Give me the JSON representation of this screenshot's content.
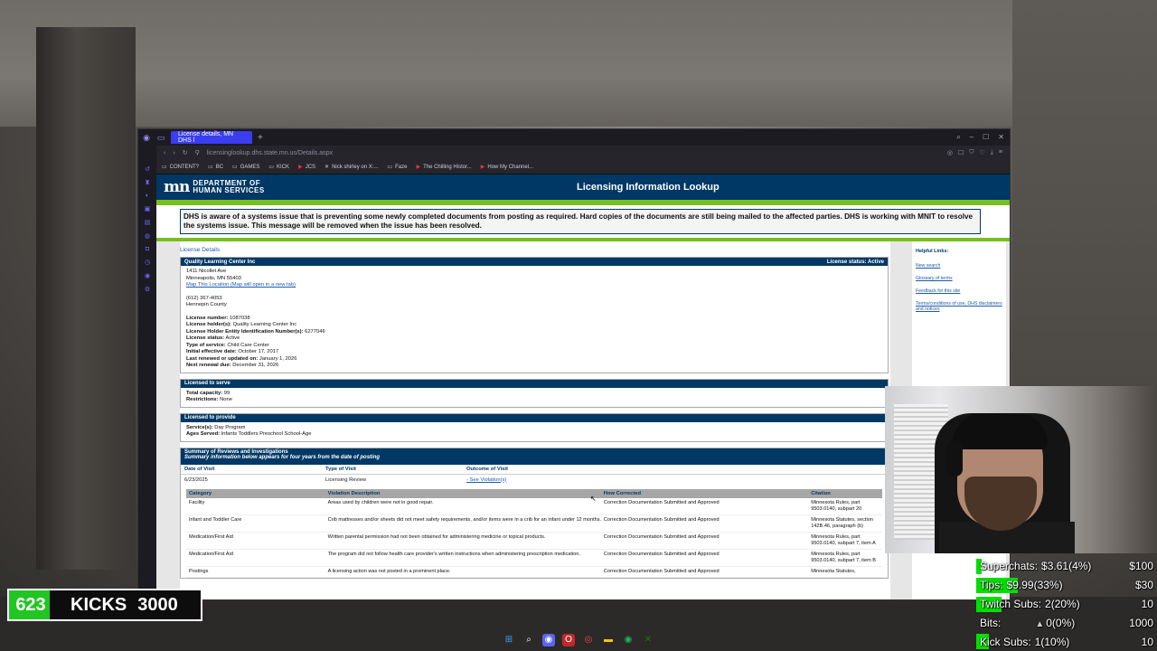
{
  "browser": {
    "tab_title": "License details, MN DHS l",
    "address": "licensinglookup.dhs.state.mn.us/Details.aspx",
    "bookmarks": [
      {
        "label": "CONTENT?",
        "icon": "folder-icon"
      },
      {
        "label": "BC",
        "icon": "folder-icon"
      },
      {
        "label": "GAMES",
        "icon": "folder-icon"
      },
      {
        "label": "KICK",
        "icon": "folder-icon"
      },
      {
        "label": "JCS",
        "icon": "youtube-icon"
      },
      {
        "label": "Nick shirley on X:...",
        "icon": "x-icon"
      },
      {
        "label": "Faze",
        "icon": "folder-icon"
      },
      {
        "label": "The Chilling Histor...",
        "icon": "youtube-icon"
      },
      {
        "label": "How My Channel...",
        "icon": "youtube-icon"
      }
    ]
  },
  "dhs": {
    "logo_line1": "DEPARTMENT OF",
    "logo_line2": "HUMAN SERVICES",
    "page_title": "Licensing Information Lookup",
    "alert": "DHS is aware of a systems issue that is preventing some newly completed documents from posting as required. Hard copies of the documents are still being mailed to the affected parties. DHS is working with MNIT to resolve the systems issue.  This message will be removed when the issue has been resolved.",
    "helpful_links": {
      "title": "Helpful Links:",
      "links": [
        "New search",
        "Glossary of terms",
        "Feedback for this site",
        "Terms/conditions of use, DHS disclaimers and notices"
      ]
    },
    "license_details_title": "License Details",
    "provider": {
      "name": "Quality Learning Center Inc",
      "status_header": "License status: Active",
      "address1": "1411 Nicollet Ave",
      "address2": "Minneapolis, MN 55403",
      "map_link": "Map This Location (Map will open in a new tab)",
      "phone": "(612) 367-4053",
      "county": "Hennepin County",
      "license_number_label": "License number:",
      "license_number": "1087038",
      "holder_label": "License holder(s):",
      "holder": "Quality Learning Center Inc",
      "entity_id_label": "License Holder Entity Identification Number(s):",
      "entity_id": "6277046",
      "status_label": "License status:",
      "status": "Active",
      "service_type_label": "Type of service:",
      "service_type": "Child Care Center",
      "initial_date_label": "Initial effective date:",
      "initial_date": "October 17, 2017",
      "renewed_label": "Last renewed or updated on:",
      "renewed": "January 1, 2026",
      "next_renewal_label": "Next renewal due:",
      "next_renewal": "December 31, 2026"
    },
    "licensed_to_serve": {
      "title": "Licensed to serve",
      "capacity_label": "Total capacity:",
      "capacity": "99",
      "restrictions_label": "Restrictions:",
      "restrictions": "None"
    },
    "licensed_to_provide": {
      "title": "Licensed to provide",
      "services_label": "Service(s):",
      "services": "Day Program",
      "ages_label": "Ages Served:",
      "ages": "Infants Toddlers Preschool School-Age"
    },
    "reviews": {
      "title": "Summary of Reviews and Investigations",
      "subtitle": "Summary information below appears for four years from the date of posting",
      "columns": [
        "Date of Visit",
        "Type of Visit",
        "Outcome of Visit"
      ],
      "row": {
        "date": "6/23/2025",
        "type": "Licensing Review",
        "outcome": "- See Violation(s)"
      },
      "violation_columns": [
        "Category",
        "Violation Description",
        "How Corrected",
        "Citation"
      ],
      "violations": [
        {
          "category": "Facility",
          "description": "Areas used by children were not in good repair.",
          "corrected": "Correction Documentation Submitted and Approved",
          "citation": "Minnesota Rules, part 9503.0140, subpart 20"
        },
        {
          "category": "Infant and Toddler Care",
          "description": "Crib mattresses and/or sheets did not meet safety requirements, and/or items were in a crib for an infant under 12 months.",
          "corrected": "Correction Documentation Submitted and Approved",
          "citation": "Minnesota Statutes, section 142B.46, paragraph (b)"
        },
        {
          "category": "Medication/First Aid",
          "description": "Written parental permission had not been obtained for administering medicine or topical products.",
          "corrected": "Correction Documentation Submitted and Approved",
          "citation": "Minnesota Rules, part 9503.0140, subpart 7, item A"
        },
        {
          "category": "Medication/First Aid",
          "description": "The program did not follow health care provider's written instructions when administering prescription medication.",
          "corrected": "Correction Documentation Submitted and Approved",
          "citation": "Minnesota Rules, part 9503.0140, subpart 7, item B"
        },
        {
          "category": "Postings",
          "description": "A licensing action was not posted in a prominent place.",
          "corrected": "Correction Documentation Submitted and Approved",
          "citation": "Minnesota Statutes,"
        }
      ]
    }
  },
  "stream": {
    "kicks": {
      "current": "623",
      "label": "KICKS",
      "goal": "3000",
      "progress": 0.21
    },
    "goals": [
      {
        "label": "Superchats:",
        "value": "$3.61(4%)",
        "target": "$100",
        "progress": 0.04
      },
      {
        "label": "Tips:",
        "value": "$9.99(33%)",
        "target": "$30",
        "progress": 0.33
      },
      {
        "label": "Twitch Subs:",
        "value": "2(20%)",
        "target": "10",
        "progress": 0.2
      },
      {
        "label": "Bits:",
        "value": "0(0%)",
        "target": "1000",
        "progress": 0.0
      },
      {
        "label": "Kick Subs:",
        "value": "1(10%)",
        "target": "10",
        "progress": 0.1
      }
    ]
  },
  "colors": {
    "dhs_navy": "#003865",
    "dhs_green": "#78be20",
    "tab_blue": "#3a3df0",
    "goal_green": "#00e000"
  }
}
